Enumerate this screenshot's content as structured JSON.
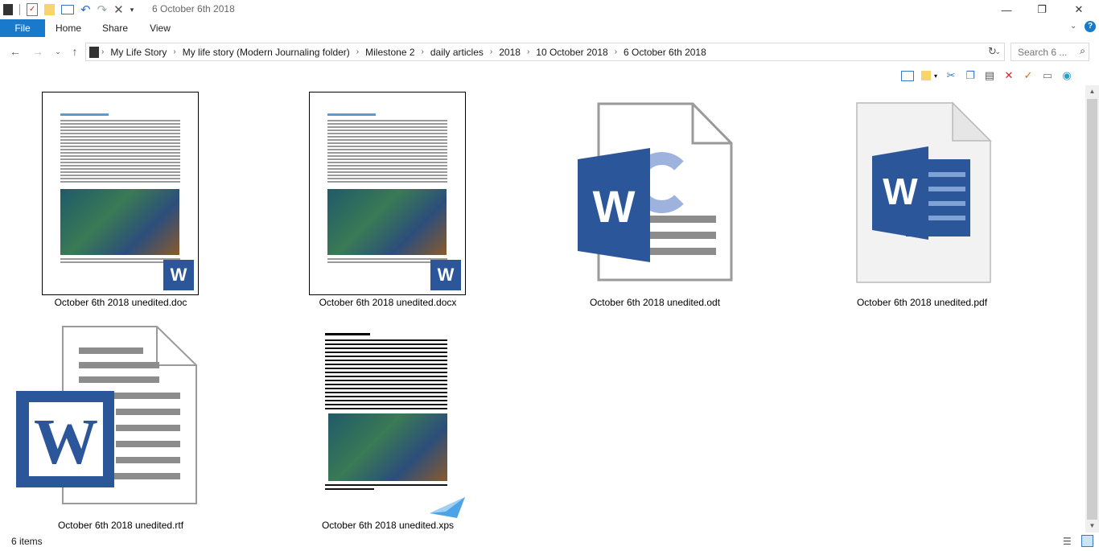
{
  "window": {
    "title": "6 October 6th 2018"
  },
  "ribbon": {
    "tabs": [
      "File",
      "Home",
      "Share",
      "View"
    ]
  },
  "address": {
    "crumbs": [
      "My Life Story",
      "My life story (Modern Journaling folder)",
      "Milestone 2",
      "daily articles",
      "2018",
      "10 October 2018",
      "6 October 6th 2018"
    ]
  },
  "search": {
    "placeholder": "Search 6 ..."
  },
  "files": [
    {
      "name": "October 6th 2018 unedited.doc",
      "icon": "word-doc-thumbnail"
    },
    {
      "name": "October 6th 2018 unedited.docx",
      "icon": "word-docx-thumbnail"
    },
    {
      "name": "October 6th 2018 unedited.odt",
      "icon": "word-odt-icon"
    },
    {
      "name": "October 6th 2018 unedited.pdf",
      "icon": "word-pdf-icon"
    },
    {
      "name": "October 6th 2018 unedited.rtf",
      "icon": "word-rtf-icon"
    },
    {
      "name": "October 6th 2018 unedited.xps",
      "icon": "xps-thumbnail"
    }
  ],
  "status": {
    "count": "6 items"
  },
  "colors": {
    "accent": "#1979ca",
    "word_blue": "#2b579a"
  }
}
